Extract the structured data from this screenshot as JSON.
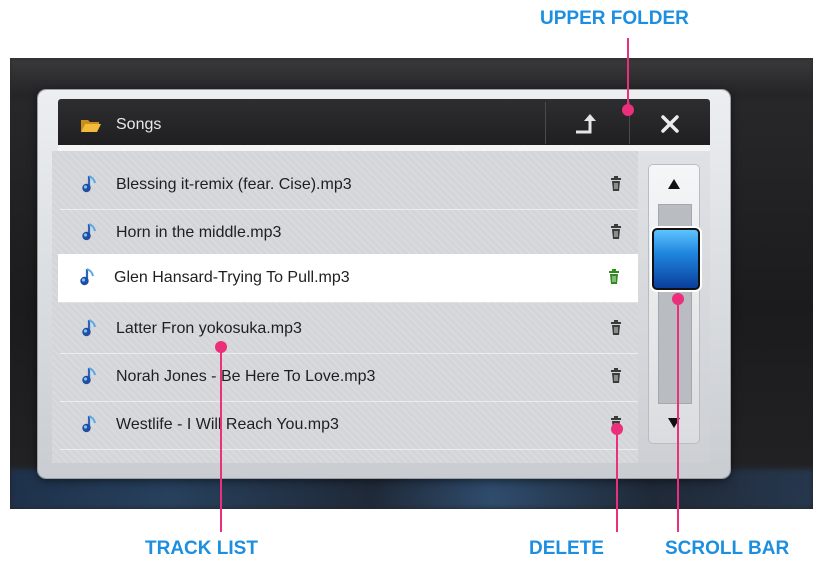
{
  "callouts": {
    "upper_folder": "UPPER FOLDER",
    "track_list": "TRACK LIST",
    "delete": "DELETE",
    "scroll_bar": "SCROLL BAR"
  },
  "header": {
    "title": "Songs"
  },
  "tracks": [
    {
      "name": "Blessing it-remix (fear. Cise).mp3",
      "selected": false
    },
    {
      "name": "Horn in the middle.mp3",
      "selected": false
    },
    {
      "name": "Glen Hansard-Trying To Pull.mp3",
      "selected": true
    },
    {
      "name": "Latter Fron yokosuka.mp3",
      "selected": false
    },
    {
      "name": "Norah Jones - Be Here To Love.mp3",
      "selected": false
    },
    {
      "name": "Westlife - I Will Reach You.mp3",
      "selected": false
    }
  ],
  "icons": {
    "folder": "folder-icon",
    "upper": "upper-folder-icon",
    "close": "close-icon",
    "track": "music-note-icon",
    "delete": "trash-icon",
    "scroll_up": "arrow-up-icon",
    "scroll_down": "arrow-down-icon"
  },
  "colors": {
    "callout_text": "#1d8fe0",
    "callout_line": "#ec2f7a",
    "thumb": "#1f86df",
    "selected_delete": "#2f8a1f"
  }
}
